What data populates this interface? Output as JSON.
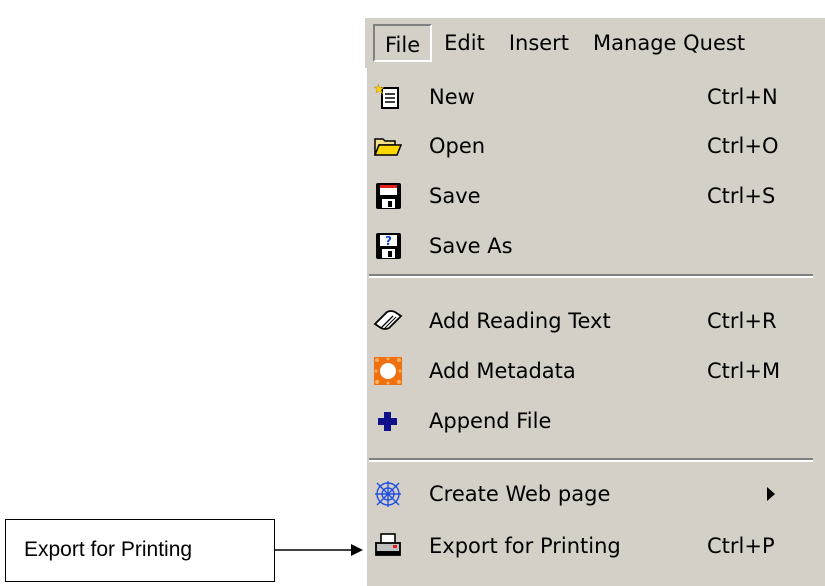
{
  "menubar": {
    "items": [
      {
        "label": "File"
      },
      {
        "label": "Edit"
      },
      {
        "label": "Insert"
      },
      {
        "label": "Manage Quest"
      }
    ]
  },
  "file_menu": {
    "items": [
      {
        "label": "New",
        "shortcut": "Ctrl+N",
        "icon": "new-document-icon"
      },
      {
        "label": "Open",
        "shortcut": "Ctrl+O",
        "icon": "open-folder-icon"
      },
      {
        "label": "Save",
        "shortcut": "Ctrl+S",
        "icon": "floppy-disk-icon"
      },
      {
        "label": "Save As",
        "shortcut": "",
        "icon": "save-as-icon"
      },
      {
        "label": "Add Reading Text",
        "shortcut": "Ctrl+R",
        "icon": "book-icon"
      },
      {
        "label": "Add Metadata",
        "shortcut": "Ctrl+M",
        "icon": "metadata-icon"
      },
      {
        "label": "Append File",
        "shortcut": "",
        "icon": "plus-icon"
      },
      {
        "label": "Create Web page",
        "shortcut": "",
        "icon": "web-icon",
        "submenu": true
      },
      {
        "label": "Export for Printing",
        "shortcut": "Ctrl+P",
        "icon": "printer-icon"
      }
    ]
  },
  "callout": {
    "text": "Export for Printing"
  },
  "colors": {
    "menu_background": "#d4d0c8",
    "separator_dark": "#808080",
    "separator_light": "#ffffff"
  }
}
